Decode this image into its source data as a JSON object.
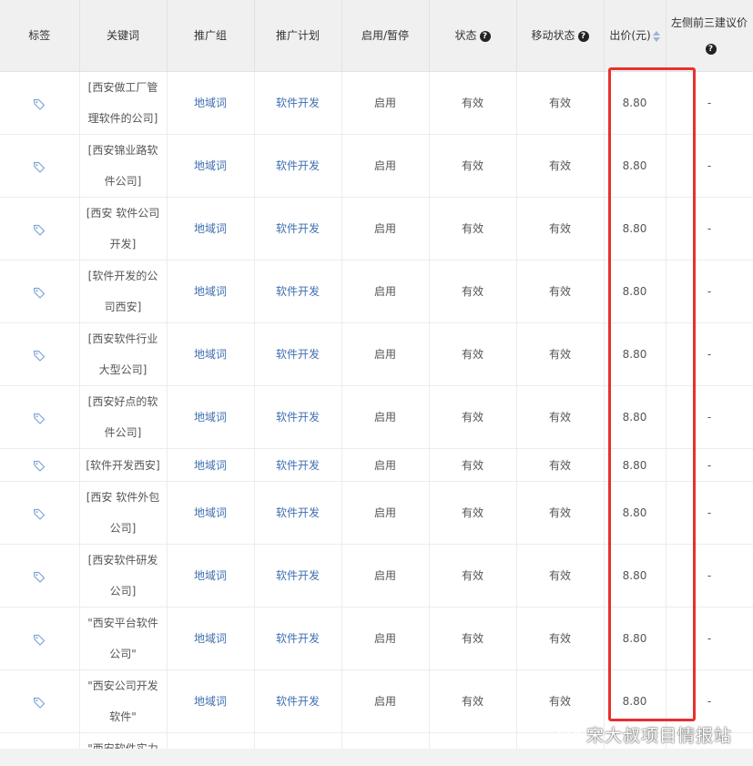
{
  "headers": {
    "tag": "标签",
    "keyword": "关键词",
    "group": "推广组",
    "plan": "推广计划",
    "toggle": "启用/暂停",
    "status": "状态",
    "mobile_status": "移动状态",
    "bid": "出价(元)",
    "suggest": "左侧前三建议价"
  },
  "rows": [
    {
      "keyword": "[西安做工厂管理软件的公司]",
      "group": "地域词",
      "plan": "软件开发",
      "toggle": "启用",
      "status": "有效",
      "mobile_status": "有效",
      "bid": "8.80",
      "suggest": "-"
    },
    {
      "keyword": "[西安锦业路软件公司]",
      "group": "地域词",
      "plan": "软件开发",
      "toggle": "启用",
      "status": "有效",
      "mobile_status": "有效",
      "bid": "8.80",
      "suggest": "-"
    },
    {
      "keyword": "[西安 软件公司开发]",
      "group": "地域词",
      "plan": "软件开发",
      "toggle": "启用",
      "status": "有效",
      "mobile_status": "有效",
      "bid": "8.80",
      "suggest": "-"
    },
    {
      "keyword": "[软件开发的公司西安]",
      "group": "地域词",
      "plan": "软件开发",
      "toggle": "启用",
      "status": "有效",
      "mobile_status": "有效",
      "bid": "8.80",
      "suggest": "-"
    },
    {
      "keyword": "[西安软件行业大型公司]",
      "group": "地域词",
      "plan": "软件开发",
      "toggle": "启用",
      "status": "有效",
      "mobile_status": "有效",
      "bid": "8.80",
      "suggest": "-"
    },
    {
      "keyword": "[西安好点的软件公司]",
      "group": "地域词",
      "plan": "软件开发",
      "toggle": "启用",
      "status": "有效",
      "mobile_status": "有效",
      "bid": "8.80",
      "suggest": "-"
    },
    {
      "keyword": "[软件开发西安]",
      "group": "地域词",
      "plan": "软件开发",
      "toggle": "启用",
      "status": "有效",
      "mobile_status": "有效",
      "bid": "8.80",
      "suggest": "-"
    },
    {
      "keyword": "[西安 软件外包公司]",
      "group": "地域词",
      "plan": "软件开发",
      "toggle": "启用",
      "status": "有效",
      "mobile_status": "有效",
      "bid": "8.80",
      "suggest": "-"
    },
    {
      "keyword": "[西安软件研发公司]",
      "group": "地域词",
      "plan": "软件开发",
      "toggle": "启用",
      "status": "有效",
      "mobile_status": "有效",
      "bid": "8.80",
      "suggest": "-"
    },
    {
      "keyword": "\"西安平台软件公司\"",
      "group": "地域词",
      "plan": "软件开发",
      "toggle": "启用",
      "status": "有效",
      "mobile_status": "有效",
      "bid": "8.80",
      "suggest": "-"
    },
    {
      "keyword": "\"西安公司开发软件\"",
      "group": "地域词",
      "plan": "软件开发",
      "toggle": "启用",
      "status": "有效",
      "mobile_status": "有效",
      "bid": "8.80",
      "suggest": "-"
    },
    {
      "keyword": "\"西安软件实力比",
      "group": "",
      "plan": "",
      "toggle": "",
      "status": "",
      "mobile_status": "",
      "bid": "",
      "suggest": ""
    }
  ],
  "icons": {
    "tag": "tag-icon",
    "help": "question-circle-icon",
    "sort": "sort-icon",
    "watermark": "wechat-icon"
  },
  "colors": {
    "highlight": "#e8302e",
    "link": "#3f6fb0",
    "header_bg": "#f0f0f0"
  },
  "watermark": {
    "text": "宋大叔项目情报站"
  }
}
